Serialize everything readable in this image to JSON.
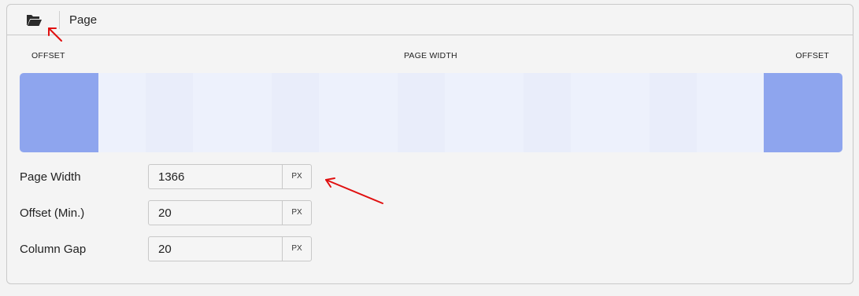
{
  "header": {
    "title": "Page",
    "folder_icon": "folder-open-icon"
  },
  "preview": {
    "offset_left_label": "OFFSET",
    "page_width_label": "PAGE WIDTH",
    "offset_right_label": "OFFSET",
    "colors": {
      "offset": "#8ea5ee",
      "page": "#edf1fc",
      "column": "#e9edfa"
    }
  },
  "fields": [
    {
      "label": "Page Width",
      "value": "1366",
      "unit": "PX"
    },
    {
      "label": "Offset (Min.)",
      "value": "20",
      "unit": "PX"
    },
    {
      "label": "Column Gap",
      "value": "20",
      "unit": "PX"
    }
  ],
  "annotations": {
    "arrow_color": "#e01010"
  }
}
